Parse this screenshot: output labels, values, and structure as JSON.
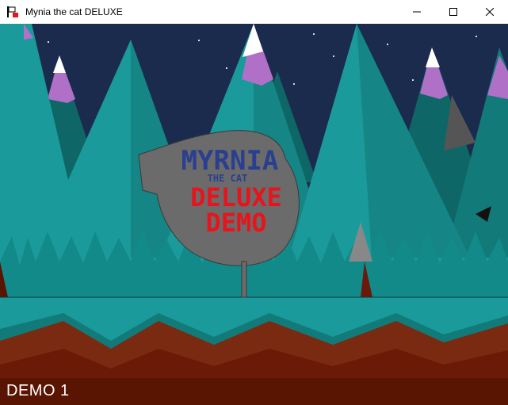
{
  "window": {
    "title": "Mynia the cat DELUXE",
    "controls": [
      "minimize",
      "maximize",
      "close"
    ]
  },
  "logo": {
    "line1": "MYRNIA",
    "line2": "THE CAT",
    "line3": "DELUXE",
    "line4": "DEMO",
    "colors": {
      "blob": "#6b6b6b",
      "title": "#2a3f8f",
      "deluxe": "#e8141c"
    }
  },
  "hud": {
    "label": "DEMO 1"
  },
  "palette": {
    "sky": "#1b2b4d",
    "tree": "#1a9a9a",
    "tree_dark": "#0f6f6f",
    "snow": "#ffffff",
    "snow_purple": "#b070c8",
    "ground_teal": "#1a9a9a",
    "ground_brown": "#7a2a10",
    "hud_bg": "#5a1402"
  }
}
